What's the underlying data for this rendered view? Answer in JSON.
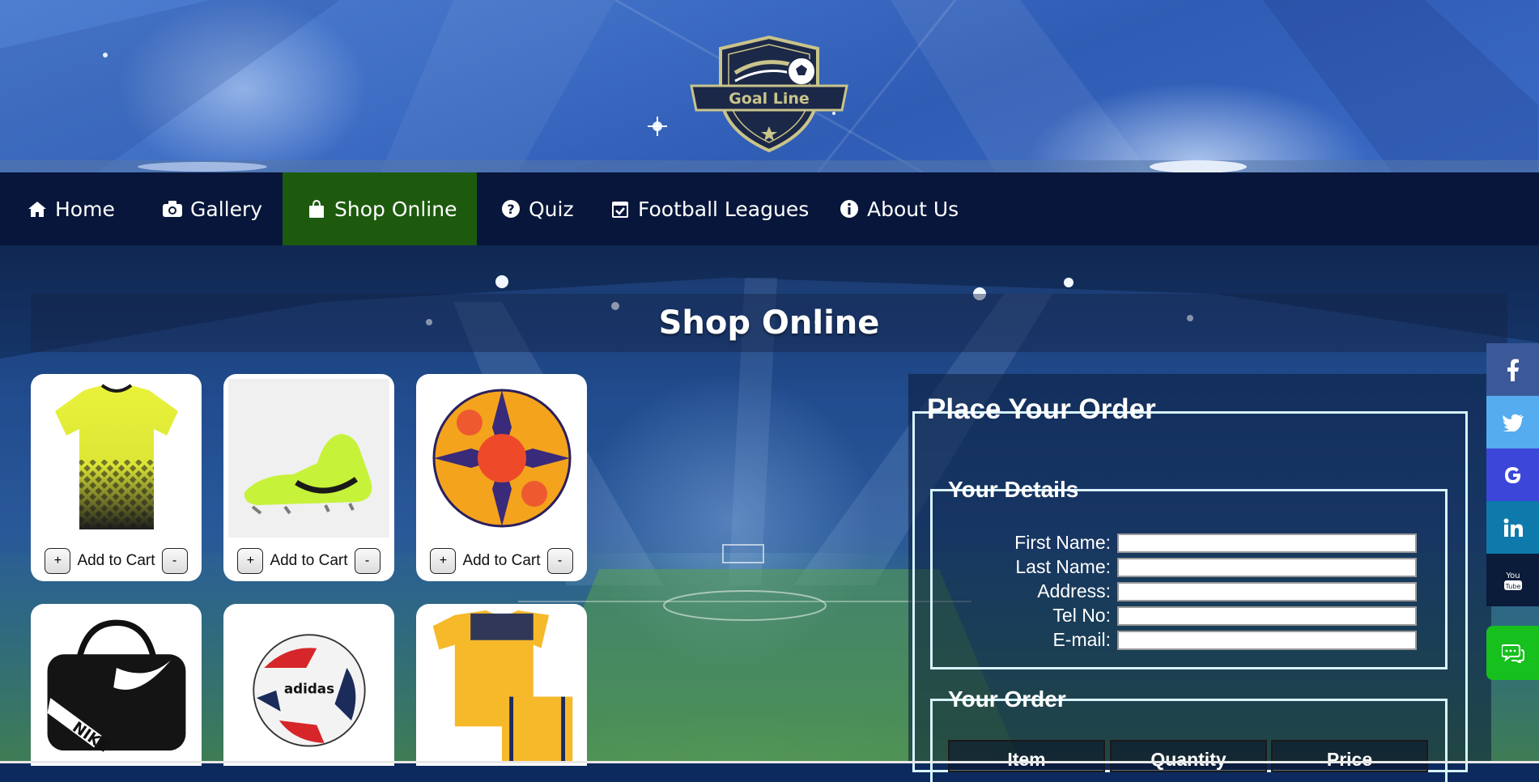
{
  "brand": {
    "logo_text": "Goal Line"
  },
  "nav": {
    "items": [
      {
        "label": "Home",
        "icon": "home-icon"
      },
      {
        "label": "Gallery",
        "icon": "camera-icon"
      },
      {
        "label": "Shop Online",
        "icon": "shopping-bag-icon",
        "active": true
      },
      {
        "label": "Quiz",
        "icon": "question-circle-icon"
      },
      {
        "label": "Football Leagues",
        "icon": "calendar-check-icon"
      },
      {
        "label": "About Us",
        "icon": "info-circle-icon"
      }
    ],
    "active_color": "#1d5a0e",
    "background": "#07163a"
  },
  "page": {
    "title": "Shop Online"
  },
  "products": [
    {
      "item": "yellow-jersey",
      "add_label": "Add to Cart",
      "plus": "+",
      "minus": "-"
    },
    {
      "item": "green-boot",
      "add_label": "Add to Cart",
      "plus": "+",
      "minus": "-"
    },
    {
      "item": "premier-league-ball",
      "add_label": "Add to Cart",
      "plus": "+",
      "minus": "-"
    },
    {
      "item": "nike-duffel-bag"
    },
    {
      "item": "adidas-ball"
    },
    {
      "item": "yellow-kit"
    }
  ],
  "order": {
    "title": "Place Your Order",
    "details": {
      "legend": "Your Details",
      "fields": [
        {
          "label": "First Name:",
          "value": ""
        },
        {
          "label": "Last Name:",
          "value": ""
        },
        {
          "label": "Address:",
          "value": ""
        },
        {
          "label": "Tel No:",
          "value": ""
        },
        {
          "label": "E-mail:",
          "value": ""
        }
      ]
    },
    "summary": {
      "legend": "Your Order",
      "columns": [
        "Item",
        "Quantity",
        "Price"
      ]
    }
  },
  "social": [
    {
      "icon": "facebook-icon",
      "color": "#3b5998"
    },
    {
      "icon": "twitter-icon",
      "color": "#55acee"
    },
    {
      "icon": "google-icon",
      "color": "#3c46d8"
    },
    {
      "icon": "linkedin-icon",
      "color": "#0e7aab"
    },
    {
      "icon": "youtube-icon",
      "color": "#0b1b3a"
    }
  ],
  "chat": {
    "icon": "chat-icon",
    "color": "#16c01d"
  }
}
